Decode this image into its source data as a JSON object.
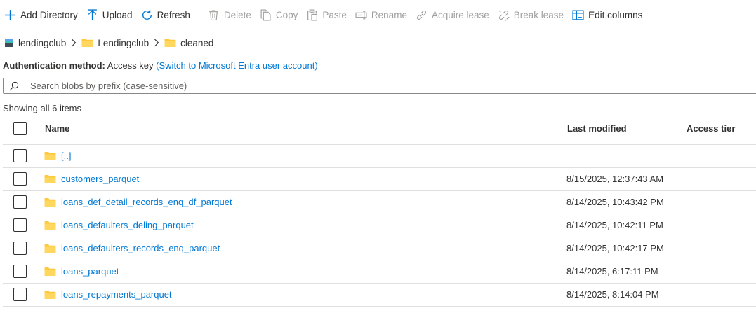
{
  "toolbar": {
    "add_directory": "Add Directory",
    "upload": "Upload",
    "refresh": "Refresh",
    "delete": "Delete",
    "copy": "Copy",
    "paste": "Paste",
    "rename": "Rename",
    "acquire_lease": "Acquire lease",
    "break_lease": "Break lease",
    "edit_columns": "Edit columns"
  },
  "breadcrumb": {
    "account": "lendingclub",
    "container": "Lendingclub",
    "folder": "cleaned"
  },
  "auth": {
    "label": "Authentication method:",
    "value": "Access key",
    "switch_link": "(Switch to Microsoft Entra user account)"
  },
  "search": {
    "placeholder": "Search blobs by prefix (case-sensitive)"
  },
  "status": {
    "showing": "Showing all 6 items"
  },
  "table": {
    "columns": {
      "name": "Name",
      "last_modified": "Last modified",
      "access_tier": "Access tier"
    },
    "rows": [
      {
        "name": "[..]",
        "modified": "",
        "tier": ""
      },
      {
        "name": "customers_parquet",
        "modified": "8/15/2025, 12:37:43 AM",
        "tier": ""
      },
      {
        "name": "loans_def_detail_records_enq_df_parquet",
        "modified": "8/14/2025, 10:43:42 PM",
        "tier": ""
      },
      {
        "name": "loans_defaulters_deling_parquet",
        "modified": "8/14/2025, 10:42:11 PM",
        "tier": ""
      },
      {
        "name": "loans_defaulters_records_enq_parquet",
        "modified": "8/14/2025, 10:42:17 PM",
        "tier": ""
      },
      {
        "name": "loans_parquet",
        "modified": "8/14/2025, 6:17:11 PM",
        "tier": ""
      },
      {
        "name": "loans_repayments_parquet",
        "modified": "8/14/2025, 8:14:04 PM",
        "tier": ""
      }
    ]
  },
  "colors": {
    "accent": "#0078d4",
    "folder": "#ffc83d",
    "disabled_text": "#a19f9d",
    "border": "#e1dfdd"
  },
  "icons": {
    "add_directory": "plus-icon",
    "upload": "upload-arrow-icon",
    "refresh": "refresh-icon",
    "delete": "trash-icon",
    "copy": "copy-icon",
    "paste": "paste-icon",
    "rename": "rename-icon",
    "acquire_lease": "link-icon",
    "break_lease": "broken-link-icon",
    "edit_columns": "columns-icon",
    "account": "storage-account-icon",
    "folder": "folder-icon",
    "search": "search-icon"
  }
}
